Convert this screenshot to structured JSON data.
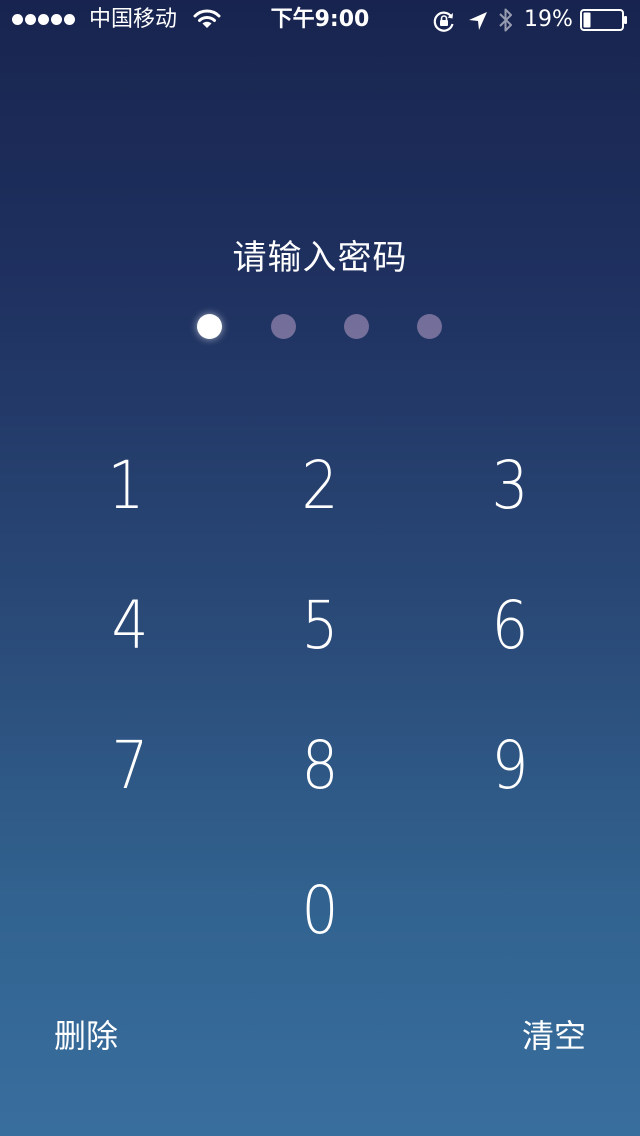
{
  "status_bar": {
    "signal_dots": 5,
    "carrier": "中国移动",
    "wifi_icon": "wifi-icon",
    "time": "下午9:00",
    "rotation_lock_icon": "rotation-lock-icon",
    "location_icon": "location-arrow-icon",
    "bluetooth_icon": "bluetooth-icon",
    "battery_percent": "19%",
    "battery_level": 0.19
  },
  "prompt": "请输入密码",
  "passcode": {
    "length": 4,
    "entered": 1
  },
  "keypad": {
    "keys": [
      "1",
      "2",
      "3",
      "4",
      "5",
      "6",
      "7",
      "8",
      "9",
      "0"
    ]
  },
  "actions": {
    "delete": "删除",
    "clear": "清空"
  },
  "colors": {
    "background_top": "#18244f",
    "background_bottom": "#386e9e",
    "dot_filled": "#ffffff",
    "dot_empty": "#8a7ea8"
  }
}
